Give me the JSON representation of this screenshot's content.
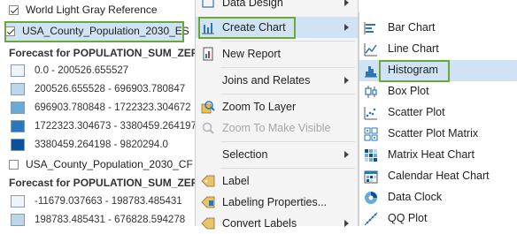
{
  "contents_pane": {
    "layers": [
      {
        "name": "World Light Gray Reference",
        "checked": true
      },
      {
        "name": "USA_County_Population_2030_ES",
        "checked": true,
        "selected": true
      },
      {
        "name": "USA_County_Population_2030_CF",
        "checked": false
      }
    ],
    "legend_es": {
      "heading": "Forecast for POPULATION_SUM_ZEROS",
      "classes": [
        {
          "label": "0.0 - 200526.655527",
          "color": "#f1f3fa"
        },
        {
          "label": "200526.655528 - 696903.780847",
          "color": "#bcd7ea"
        },
        {
          "label": "696903.780848 - 1722323.304672",
          "color": "#6aaad6"
        },
        {
          "label": "1722323.304673 - 3380459.264197",
          "color": "#2a77bd"
        },
        {
          "label": "3380459.264198 - 9820294.0",
          "color": "#08519c"
        }
      ]
    },
    "legend_cf": {
      "heading": "Forecast for POPULATION_SUM_ZEROS",
      "classes": [
        {
          "label": "-11679.037663 - 198783.485431",
          "color": "#f1f3fa"
        },
        {
          "label": "198783.485431 - 676828.594278",
          "color": "#bcd7ea"
        }
      ]
    }
  },
  "context_menu": {
    "items": [
      {
        "label": "Data Design",
        "icon": "data-design-icon",
        "submenu": true
      },
      {
        "label": "Create Chart",
        "icon": "bar-chart-icon",
        "submenu": true,
        "highlighted": true
      },
      {
        "label": "New Report",
        "icon": "report-icon"
      },
      {
        "label": "Joins and Relates",
        "submenu": true
      },
      {
        "label": "Zoom To Layer",
        "icon": "zoom-to-layer-icon"
      },
      {
        "label": "Zoom To Make Visible",
        "icon": "zoom-visible-icon",
        "disabled": true
      },
      {
        "label": "Selection",
        "submenu": true
      },
      {
        "label": "Label",
        "icon": "label-icon"
      },
      {
        "label": "Labeling Properties...",
        "icon": "labeling-properties-icon"
      },
      {
        "label": "Convert Labels",
        "icon": "convert-labels-icon",
        "submenu": true
      }
    ]
  },
  "chart_submenu": {
    "items": [
      {
        "label": "Bar Chart",
        "icon": "bar-chart-icon"
      },
      {
        "label": "Line Chart",
        "icon": "line-chart-icon"
      },
      {
        "label": "Histogram",
        "icon": "histogram-icon",
        "highlighted": true
      },
      {
        "label": "Box Plot",
        "icon": "box-plot-icon"
      },
      {
        "label": "Scatter Plot",
        "icon": "scatter-plot-icon"
      },
      {
        "label": "Scatter Plot Matrix",
        "icon": "scatter-plot-matrix-icon"
      },
      {
        "label": "Matrix Heat Chart",
        "icon": "matrix-heat-chart-icon"
      },
      {
        "label": "Calendar Heat Chart",
        "icon": "calendar-heat-chart-icon"
      },
      {
        "label": "Data Clock",
        "icon": "data-clock-icon"
      },
      {
        "label": "QQ Plot",
        "icon": "qq-plot-icon"
      }
    ]
  },
  "colors": {
    "highlight_green": "#6aa838",
    "menu_highlight": "#cfe3f5",
    "icon_blue": "#2e75b6"
  }
}
